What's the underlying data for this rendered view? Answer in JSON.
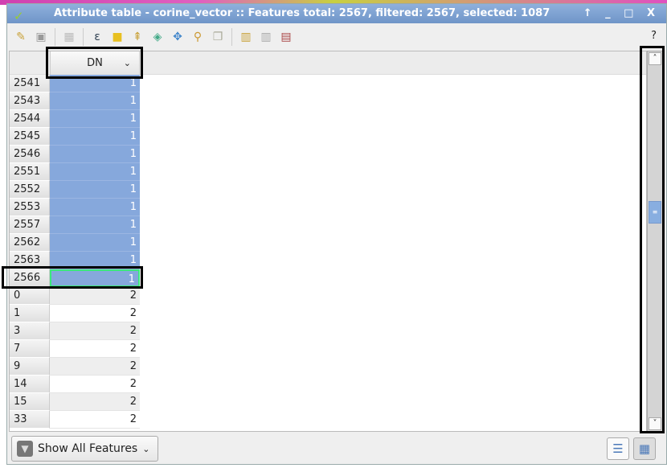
{
  "window": {
    "title": "Attribute table - corine_vector :: Features total: 2567, filtered: 2567, selected: 1087",
    "controls": "↑ _ □ X"
  },
  "toolbar": {
    "icons": [
      "pencil-icon",
      "save-icon",
      "delete-selected-icon",
      "expression-select-icon",
      "deselect-icon",
      "move-selection-top-icon",
      "invert-selection-icon",
      "pan-to-selection-icon",
      "zoom-to-selection-icon",
      "copy-icon",
      "new-column-icon",
      "delete-column-icon",
      "field-calculator-icon"
    ],
    "help": "?"
  },
  "table": {
    "column": "DN",
    "rows": [
      {
        "id": "2541",
        "value": "1",
        "selected": true
      },
      {
        "id": "2543",
        "value": "1",
        "selected": true
      },
      {
        "id": "2544",
        "value": "1",
        "selected": true
      },
      {
        "id": "2545",
        "value": "1",
        "selected": true
      },
      {
        "id": "2546",
        "value": "1",
        "selected": true
      },
      {
        "id": "2551",
        "value": "1",
        "selected": true
      },
      {
        "id": "2552",
        "value": "1",
        "selected": true
      },
      {
        "id": "2553",
        "value": "1",
        "selected": true
      },
      {
        "id": "2557",
        "value": "1",
        "selected": true
      },
      {
        "id": "2562",
        "value": "1",
        "selected": true
      },
      {
        "id": "2563",
        "value": "1",
        "selected": true
      },
      {
        "id": "2566",
        "value": "1",
        "selected": true,
        "current": true
      },
      {
        "id": "0",
        "value": "2"
      },
      {
        "id": "1",
        "value": "2"
      },
      {
        "id": "3",
        "value": "2"
      },
      {
        "id": "7",
        "value": "2"
      },
      {
        "id": "9",
        "value": "2"
      },
      {
        "id": "14",
        "value": "2"
      },
      {
        "id": "15",
        "value": "2"
      },
      {
        "id": "33",
        "value": "2"
      }
    ]
  },
  "filter": {
    "label": "Show All Features"
  },
  "colors": {
    "selection": "#86a8dc",
    "current": "#3be87c",
    "titlebar": "#7fa3d3"
  }
}
